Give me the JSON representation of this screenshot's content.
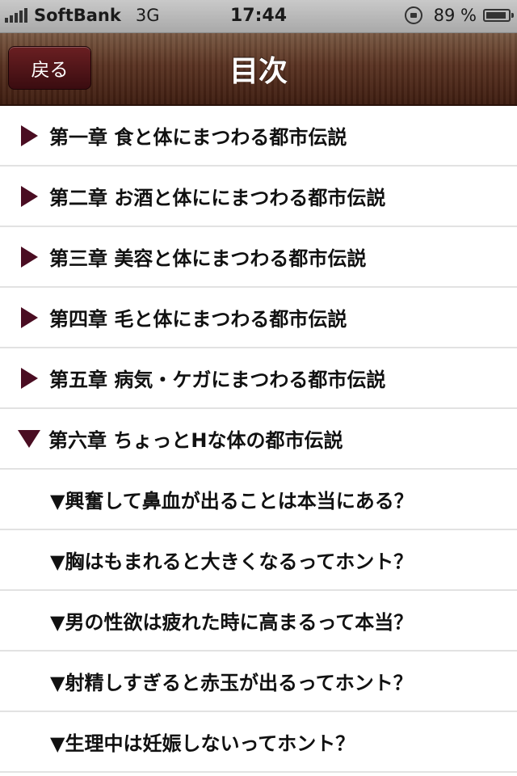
{
  "status_bar": {
    "carrier": "SoftBank",
    "network": "3G",
    "time": "17:44",
    "battery": "89 %"
  },
  "nav": {
    "back_label": "戻る",
    "title": "目次"
  },
  "items": [
    {
      "type": "chapter",
      "expanded": false,
      "label": "第一章 食と体にまつわる都市伝説"
    },
    {
      "type": "chapter",
      "expanded": false,
      "label": "第二章 お酒と体ににまつわる都市伝説"
    },
    {
      "type": "chapter",
      "expanded": false,
      "label": "第三章 美容と体にまつわる都市伝説"
    },
    {
      "type": "chapter",
      "expanded": false,
      "label": "第四章 毛と体にまつわる都市伝説"
    },
    {
      "type": "chapter",
      "expanded": false,
      "label": "第五章 病気・ケガにまつわる都市伝説"
    },
    {
      "type": "chapter",
      "expanded": true,
      "label": "第六章 ちょっとHな体の都市伝説"
    },
    {
      "type": "sub",
      "label": "▼興奮して鼻血が出ることは本当にある？"
    },
    {
      "type": "sub",
      "label": "▼胸はもまれると大きくなるってホント？"
    },
    {
      "type": "sub",
      "label": "▼男の性欲は疲れた時に高まるって本当？"
    },
    {
      "type": "sub",
      "label": "▼射精しすぎると赤玉が出るってホント？"
    },
    {
      "type": "sub",
      "label": "▼生理中は妊娠しないってホント？"
    }
  ],
  "colors": {
    "accent": "#4a0d22",
    "navbar": "#5a3322",
    "back_button": "#6a1f22"
  }
}
